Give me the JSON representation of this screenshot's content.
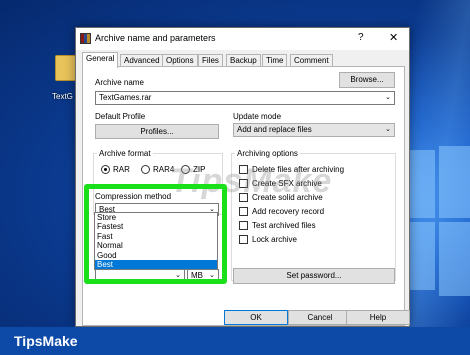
{
  "desktop": {
    "icon_label": "TextG"
  },
  "dialog": {
    "title": "Archive name and parameters",
    "help_glyph": "?",
    "close_glyph": "✕",
    "tabs": [
      "General",
      "Advanced",
      "Options",
      "Files",
      "Backup",
      "Time",
      "Comment"
    ],
    "archive_name_label": "Archive name",
    "archive_name_value": "TextGames.rar",
    "browse_label": "Browse...",
    "default_profile_label": "Default Profile",
    "profiles_label": "Profiles...",
    "update_mode_label": "Update mode",
    "update_mode_value": "Add and replace files",
    "archive_format_label": "Archive format",
    "formats": [
      "RAR",
      "RAR4",
      "ZIP"
    ],
    "selected_format": "RAR",
    "compression_method_label": "Compression method",
    "compression_method_value": "Best",
    "compression_options": [
      "Store",
      "Fastest",
      "Fast",
      "Normal",
      "Good",
      "Best"
    ],
    "selected_option": "Best",
    "split_unit": "MB",
    "archiving_options_label": "Archiving options",
    "archiving_options": [
      "Delete files after archiving",
      "Create SFX archive",
      "Create solid archive",
      "Add recovery record",
      "Test archived files",
      "Lock archive"
    ],
    "set_password_label": "Set password...",
    "ok_label": "OK",
    "cancel_label": "Cancel",
    "help_label": "Help"
  },
  "watermark": "TipsMake",
  "brand": "TipsMake",
  "colors": {
    "highlight": "#19e019",
    "selection": "#0078d7",
    "brand_bar": "#0d4aa8"
  }
}
